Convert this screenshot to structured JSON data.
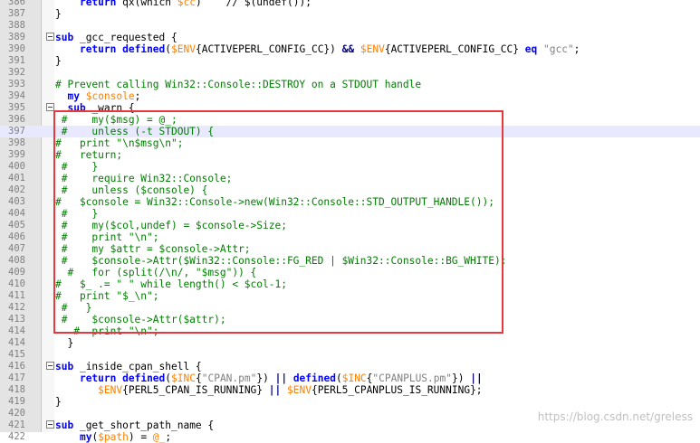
{
  "editor": {
    "lines": [
      {
        "n": "386",
        "code": "    return qx(which $cc)    // $(undef());",
        "partial": true
      },
      {
        "n": "387",
        "code": "}"
      },
      {
        "n": "388",
        "code": ""
      },
      {
        "n": "389",
        "code": "sub _gcc_requested {"
      },
      {
        "n": "390",
        "code": "    return defined($ENV{ACTIVEPERL_CONFIG_CC}) && $ENV{ACTIVEPERL_CONFIG_CC} eq \"gcc\";"
      },
      {
        "n": "391",
        "code": "}"
      },
      {
        "n": "392",
        "code": ""
      },
      {
        "n": "393",
        "code": "# Prevent calling Win32::Console::DESTROY on a STDOUT handle"
      },
      {
        "n": "394",
        "code": "  my $console;"
      },
      {
        "n": "395",
        "code": "  sub _warn {"
      },
      {
        "n": "396",
        "code": " #    my($msg) = @_;"
      },
      {
        "n": "397",
        "code": " #    unless (-t STDOUT) {"
      },
      {
        "n": "398",
        "code": "#   print \"\\n$msg\\n\";"
      },
      {
        "n": "399",
        "code": "#   return;"
      },
      {
        "n": "400",
        "code": " #    }"
      },
      {
        "n": "401",
        "code": " #    require Win32::Console;"
      },
      {
        "n": "402",
        "code": " #    unless ($console) {"
      },
      {
        "n": "403",
        "code": "#   $console = Win32::Console->new(Win32::Console::STD_OUTPUT_HANDLE());"
      },
      {
        "n": "404",
        "code": " #    }"
      },
      {
        "n": "405",
        "code": " #    my($col,undef) = $console->Size;"
      },
      {
        "n": "406",
        "code": " #    print \"\\n\";"
      },
      {
        "n": "407",
        "code": " #    my $attr = $console->Attr;"
      },
      {
        "n": "408",
        "code": " #    $console->Attr($Win32::Console::FG_RED | $Win32::Console::BG_WHITE);"
      },
      {
        "n": "409",
        "code": "  #   for (split(/\\n/, \"$msg\")) {"
      },
      {
        "n": "410",
        "code": "#   $_ .= \" \" while length() < $col-1;"
      },
      {
        "n": "411",
        "code": "#   print \"$_\\n\";"
      },
      {
        "n": "412",
        "code": " #   }"
      },
      {
        "n": "413",
        "code": " #    $console->Attr($attr);"
      },
      {
        "n": "414",
        "code": "   #  print \"\\n\";"
      },
      {
        "n": "414b",
        "code": "  }"
      },
      {
        "n": "415",
        "code": ""
      },
      {
        "n": "416",
        "code": "sub _inside_cpan_shell {"
      },
      {
        "n": "417",
        "code": "    return defined($INC{\"CPAN.pm\"}) || defined($INC{\"CPANPLUS.pm\"}) ||"
      },
      {
        "n": "418",
        "code": "       $ENV{PERL5_CPAN_IS_RUNNING} || $ENV{PERL5_CPANPLUS_IS_RUNNING};"
      },
      {
        "n": "419",
        "code": "}"
      },
      {
        "n": "420",
        "code": ""
      },
      {
        "n": "421",
        "code": "sub _get_short_path_name {"
      },
      {
        "n": "422",
        "code": "    my($path) = @_;"
      }
    ]
  },
  "watermark": "https://blog.csdn.net/greless",
  "colors": {
    "highlight_box": "#e8383c",
    "comment": "#008000",
    "keyword": "#0000ff",
    "variable": "#ff8000"
  }
}
